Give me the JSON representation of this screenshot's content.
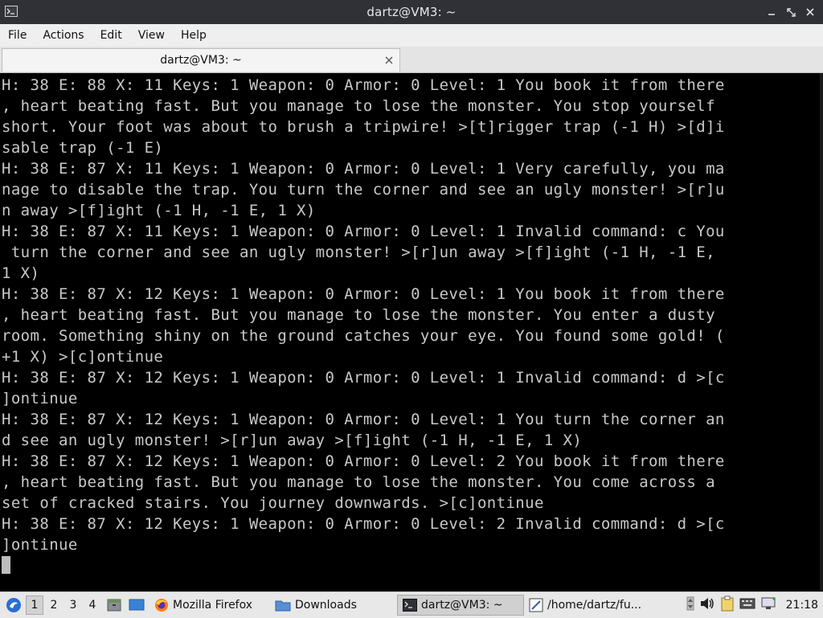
{
  "window": {
    "title": "dartz@VM3: ~"
  },
  "menu": [
    "File",
    "Actions",
    "Edit",
    "View",
    "Help"
  ],
  "tab": {
    "label": "dartz@VM3: ~"
  },
  "terminal": {
    "lines": [
      "H: 38 E: 88 X: 11 Keys: 1 Weapon: 0 Armor: 0 Level: 1 You book it from there",
      ", heart beating fast. But you manage to lose the monster. You stop yourself",
      "short. Your foot was about to brush a tripwire! >[t]rigger trap (-1 H) >[d]i",
      "sable trap (-1 E)",
      "H: 38 E: 87 X: 11 Keys: 1 Weapon: 0 Armor: 0 Level: 1 Very carefully, you ma",
      "nage to disable the trap. You turn the corner and see an ugly monster! >[r]u",
      "n away >[f]ight (-1 H, -1 E, 1 X)",
      "H: 38 E: 87 X: 11 Keys: 1 Weapon: 0 Armor: 0 Level: 1 Invalid command: c You",
      " turn the corner and see an ugly monster! >[r]un away >[f]ight (-1 H, -1 E,",
      "1 X)",
      "H: 38 E: 87 X: 12 Keys: 1 Weapon: 0 Armor: 0 Level: 1 You book it from there",
      ", heart beating fast. But you manage to lose the monster. You enter a dusty",
      "room. Something shiny on the ground catches your eye. You found some gold! (",
      "+1 X) >[c]ontinue",
      "H: 38 E: 87 X: 12 Keys: 1 Weapon: 0 Armor: 0 Level: 1 Invalid command: d >[c",
      "]ontinue",
      "H: 38 E: 87 X: 12 Keys: 1 Weapon: 0 Armor: 0 Level: 1 You turn the corner an",
      "d see an ugly monster! >[r]un away >[f]ight (-1 H, -1 E, 1 X)",
      "H: 38 E: 87 X: 12 Keys: 1 Weapon: 0 Armor: 0 Level: 2 You book it from there",
      ", heart beating fast. But you manage to lose the monster. You come across a",
      "set of cracked stairs. You journey downwards. >[c]ontinue",
      "H: 38 E: 87 X: 12 Keys: 1 Weapon: 0 Armor: 0 Level: 2 Invalid command: d >[c",
      "]ontinue"
    ]
  },
  "taskbar": {
    "workspaces": [
      "1",
      "2",
      "3",
      "4"
    ],
    "tasks": [
      {
        "label": "Mozilla Firefox",
        "icon": "firefox-icon"
      },
      {
        "label": "Downloads",
        "icon": "folder-icon"
      },
      {
        "label": "dartz@VM3: ~",
        "icon": "terminal-icon"
      },
      {
        "label": "/home/dartz/fu...",
        "icon": "text-editor-icon"
      }
    ],
    "clock": "21:18"
  },
  "colors": {
    "terminal_bg": "#000000",
    "terminal_fg": "#c8c8c8",
    "titlebar_bg": "#2f3136",
    "menubar_bg": "#efefef"
  }
}
